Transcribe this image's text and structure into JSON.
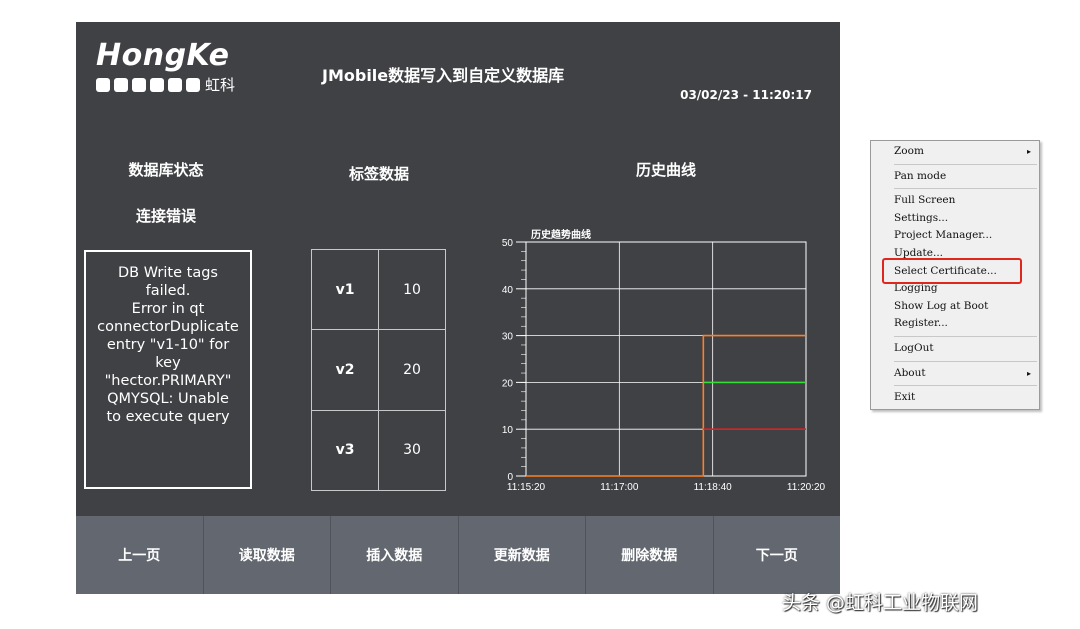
{
  "logo": {
    "word": "HongKe",
    "cn": "虹科"
  },
  "header": {
    "title": "JMobile数据写入到自定义数据库",
    "datetime": "03/02/23 - 11:20:17"
  },
  "db_status": {
    "heading": "数据库状态",
    "status": "连接错误",
    "error_lines": [
      "DB Write tags",
      "failed.",
      "Error in qt",
      "connectorDuplicate",
      "entry \"v1-10\" for",
      "key",
      "\"hector.PRIMARY\"",
      "QMYSQL: Unable",
      "to execute query"
    ]
  },
  "tags": {
    "heading": "标签数据",
    "rows": [
      {
        "name": "v1",
        "value": "10"
      },
      {
        "name": "v2",
        "value": "20"
      },
      {
        "name": "v3",
        "value": "30"
      }
    ]
  },
  "history": {
    "heading": "历史曲线"
  },
  "chart_data": {
    "type": "line",
    "title": "历史趋势曲线",
    "xlabel": "",
    "ylabel": "",
    "x_ticks": [
      "11:15:20",
      "11:17:00",
      "11:18:40",
      "11:20:20"
    ],
    "y_ticks": [
      0,
      10,
      20,
      30,
      40,
      50
    ],
    "ylim": [
      0,
      50
    ],
    "grid": true,
    "series": [
      {
        "color": "#ff7f27",
        "x": [
          "11:15:20",
          "11:18:30",
          "11:18:30",
          "11:20:20"
        ],
        "y": [
          0,
          0,
          30,
          30
        ]
      },
      {
        "color": "#33e033",
        "x": [
          "11:18:30",
          "11:20:20"
        ],
        "y": [
          20,
          20
        ]
      },
      {
        "color": "#e02020",
        "x": [
          "11:18:30",
          "11:20:20"
        ],
        "y": [
          10,
          10
        ]
      }
    ]
  },
  "buttons": [
    "上一页",
    "读取数据",
    "插入数据",
    "更新数据",
    "删除数据",
    "下一页"
  ],
  "context_menu": {
    "items": [
      {
        "label": "Zoom",
        "submenu": true
      },
      {
        "sep": true
      },
      {
        "label": "Pan mode"
      },
      {
        "sep": true
      },
      {
        "label": "Full Screen"
      },
      {
        "label": "Settings..."
      },
      {
        "label": "Project Manager..."
      },
      {
        "label": "Update..."
      },
      {
        "label": "Select Certificate..."
      },
      {
        "label": "Logging"
      },
      {
        "label": "Show Log at Boot"
      },
      {
        "label": "Register..."
      },
      {
        "sep": true
      },
      {
        "label": "LogOut"
      },
      {
        "sep": true
      },
      {
        "label": "About",
        "submenu": true
      },
      {
        "sep": true
      },
      {
        "label": "Exit"
      }
    ],
    "submenu_arrow": "▸",
    "highlight_color": "#e0271d"
  },
  "watermark": "头条 @虹科工业物联网",
  "colors": {
    "panel": "#3f4144",
    "button_bar": "#636870"
  }
}
